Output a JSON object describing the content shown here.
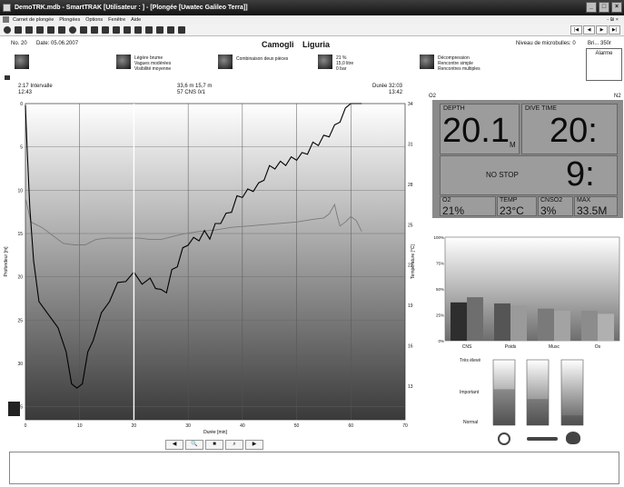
{
  "window": {
    "title": "DemoTRK.mdb - SmartTRAK [Utilisateur : ] - [Plongée [Uwatec Galileo Terra]]",
    "min_label": "_",
    "max_label": "□",
    "close_label": "×"
  },
  "menu": {
    "items": [
      "Carnet de plongée",
      "Plongées",
      "Options",
      "Fenêtre",
      "Aide"
    ],
    "mdi_controls": "- ₪ ×"
  },
  "nav": {
    "first": "|◀",
    "prev": "◀",
    "next": "▶",
    "last": "▶|"
  },
  "dive": {
    "number": "No. 20",
    "date": "Date: 05.06.2007",
    "site": "Camogli",
    "region": "Liguria",
    "microbubble": "Niveau de microbulles: 0",
    "other_readout": "Bri... 350r",
    "alarm_label": "Alarme"
  },
  "conditions": [
    {
      "lines": [
        "Légère brume",
        "Vagues modérées",
        "Visibilité moyenne"
      ]
    },
    {
      "lines": [
        "Combinaison deux pièces"
      ]
    },
    {
      "lines": [
        "21 %",
        "15,0 litre",
        "0 bar"
      ]
    },
    {
      "lines": [
        "Décompression",
        "Rencontre simple",
        "Rencontres multiples"
      ]
    }
  ],
  "chart_header": {
    "left_line1": "2:17  Intervalle",
    "left_line2": "12:43",
    "mid_line1": "33,6 m     15,7 m",
    "mid_line2": "57     CNS  0/1",
    "right_line1": "Durée  32:03",
    "right_line2": "13:42"
  },
  "chart_data": {
    "type": "line",
    "xlabel": "Durée [min]",
    "ylabel_left": "Profondeur [m]",
    "ylabel_right": "Température [°C]",
    "x_ticks": [
      0,
      10,
      20,
      30,
      40,
      50,
      60,
      70
    ],
    "depth_ticks": [
      0,
      5,
      10,
      15,
      20,
      25,
      30,
      35
    ],
    "temp_ticks": [
      34,
      31,
      28,
      25,
      22,
      19,
      16,
      13
    ],
    "xlim": [
      0,
      70
    ],
    "depth_lim": [
      0,
      36.5
    ],
    "temp_lim": [
      10.5,
      34
    ],
    "cursor_x": 20,
    "series": [
      {
        "kind": "depth",
        "points": [
          [
            0,
            0.2
          ],
          [
            0.3,
            5
          ],
          [
            0.8,
            12
          ],
          [
            1.5,
            18.5
          ],
          [
            2.5,
            22.5
          ],
          [
            4,
            24.5
          ],
          [
            6,
            25.5
          ],
          [
            7.5,
            29
          ],
          [
            8.5,
            32
          ],
          [
            9.5,
            33.2
          ],
          [
            10.5,
            32
          ],
          [
            11.5,
            29
          ],
          [
            12.5,
            27
          ],
          [
            14,
            24.5
          ],
          [
            15.5,
            22.5
          ],
          [
            17,
            21
          ],
          [
            18.5,
            20.2
          ],
          [
            20,
            19.8
          ],
          [
            21.5,
            20.5
          ],
          [
            23,
            20.5
          ],
          [
            24,
            21
          ],
          [
            25,
            21.8
          ],
          [
            26,
            21.5
          ],
          [
            27,
            19.5
          ],
          [
            28,
            18.5
          ],
          [
            29,
            17
          ],
          [
            30,
            16
          ],
          [
            31,
            15.8
          ],
          [
            32,
            15.5
          ],
          [
            33,
            15
          ],
          [
            34,
            15.3
          ],
          [
            35,
            14.2
          ],
          [
            36,
            13.5
          ],
          [
            37,
            13
          ],
          [
            38,
            12.2
          ],
          [
            39,
            11
          ],
          [
            40,
            10.5
          ],
          [
            41,
            10.2
          ],
          [
            42,
            9.8
          ],
          [
            43,
            9.5
          ],
          [
            44,
            8.5
          ],
          [
            45,
            7.5
          ],
          [
            46,
            7.2
          ],
          [
            47,
            7
          ],
          [
            48,
            6.8
          ],
          [
            49,
            6.5
          ],
          [
            50,
            6.2
          ],
          [
            51,
            6
          ],
          [
            52,
            5.5
          ],
          [
            53,
            4.8
          ],
          [
            54,
            4.5
          ],
          [
            55,
            4
          ],
          [
            56,
            3.5
          ],
          [
            57,
            2.8
          ],
          [
            58,
            1.8
          ],
          [
            59,
            0.5
          ],
          [
            60,
            0
          ],
          [
            62,
            0
          ]
        ]
      },
      {
        "kind": "temperature",
        "points": [
          [
            0,
            27
          ],
          [
            1,
            25.2
          ],
          [
            3,
            24.8
          ],
          [
            5,
            24.2
          ],
          [
            7,
            23.6
          ],
          [
            9,
            23.5
          ],
          [
            11,
            23.5
          ],
          [
            13,
            23.9
          ],
          [
            15,
            24.0
          ],
          [
            17,
            24.0
          ],
          [
            19,
            24.0
          ],
          [
            21,
            24.0
          ],
          [
            23,
            23.9
          ],
          [
            25,
            23.9
          ],
          [
            27,
            24.1
          ],
          [
            29,
            24.3
          ],
          [
            32,
            24.5
          ],
          [
            35,
            24.6
          ],
          [
            38,
            24.8
          ],
          [
            41,
            24.9
          ],
          [
            44,
            25.0
          ],
          [
            47,
            25.1
          ],
          [
            50,
            25.2
          ],
          [
            53,
            25.4
          ],
          [
            55,
            25.5
          ],
          [
            56,
            25.8
          ],
          [
            57,
            26.5
          ],
          [
            57.5,
            25.6
          ],
          [
            58,
            24.9
          ],
          [
            59,
            25.2
          ],
          [
            60,
            25.6
          ],
          [
            61,
            25.3
          ],
          [
            62,
            24.5
          ]
        ]
      }
    ],
    "bar_chart": {
      "type": "bar",
      "categories": [
        "CNS",
        "Poids",
        "Musc",
        "Os"
      ],
      "y_ticks": [
        "100%",
        "75%",
        "50%",
        "25%",
        "0%"
      ],
      "ylim": [
        0,
        100
      ],
      "values_dark": [
        37,
        36,
        31,
        29
      ],
      "values_light": [
        42,
        34,
        29,
        26
      ]
    },
    "gauges": {
      "labels": [
        "Très élevé",
        "Important",
        "Normal"
      ],
      "levels": [
        0.55,
        0.4,
        0.15
      ]
    }
  },
  "dive_computer": {
    "o2_top": "O2",
    "n2_top": "N2",
    "depth_label": "DEPTH",
    "depth_value": "20.1",
    "depth_unit": "M",
    "dive_time_label": "DIVE TIME",
    "dive_time_value": "20:",
    "no_stop": "NO STOP",
    "stop_value": "9:",
    "o2_label": "O2",
    "o2_value": "21%",
    "temp_label": "TEMP",
    "temp_value": "23°C",
    "cns_label": "CNSO2",
    "cns_value": "3%",
    "max_label": "MAX",
    "max_value": "33.5M"
  },
  "bottom_nav": [
    "◀",
    "🔍",
    "■",
    "⌕",
    "▶"
  ],
  "colors": {
    "titlebar": "#202020",
    "chart_top": "#ffffff",
    "chart_bottom": "#3a3a3a",
    "depth_line": "#000000",
    "temp_line": "#7a7a7a",
    "computer_bg": "#8a8a8a"
  }
}
